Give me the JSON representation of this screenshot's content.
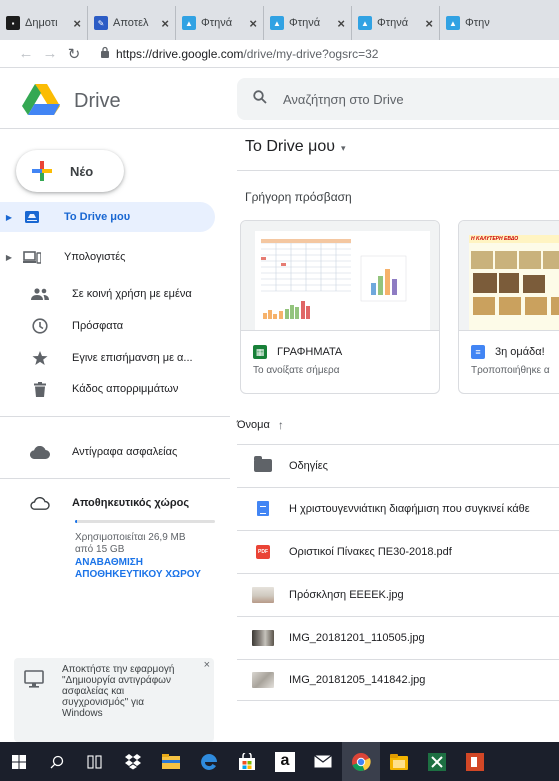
{
  "browser": {
    "tabs": [
      {
        "title": "Δημοτι",
        "close": "×",
        "icon": "school-favicon"
      },
      {
        "title": "Αποτελ",
        "close": "×",
        "icon": "blue-doc-favicon"
      },
      {
        "title": "Φτηνά",
        "close": "×",
        "icon": "flights-favicon"
      },
      {
        "title": "Φτηνά",
        "close": "×",
        "icon": "flights-favicon"
      },
      {
        "title": "Φτηνά",
        "close": "×",
        "icon": "flights-favicon"
      },
      {
        "title": "Φτην",
        "close": "",
        "icon": "flights-favicon"
      }
    ],
    "url_host": "https://drive.google.com",
    "url_path": "/drive/my-drive?ogsrc=32"
  },
  "header": {
    "app_name": "Drive",
    "search_placeholder": "Αναζήτηση στο Drive"
  },
  "sidebar": {
    "new_label": "Νέο",
    "items": [
      {
        "label": "Το Drive μου",
        "icon": "my-drive-icon",
        "active": true,
        "expandable": true
      },
      {
        "label": "Υπολογιστές",
        "icon": "computers-icon",
        "active": false,
        "expandable": true
      },
      {
        "label": "Σε κοινή χρήση με εμένα",
        "icon": "shared-icon",
        "active": false,
        "expandable": false
      },
      {
        "label": "Πρόσφατα",
        "icon": "clock-icon",
        "active": false,
        "expandable": false
      },
      {
        "label": "Εγινε επισήμανση με α...",
        "icon": "star-icon",
        "active": false,
        "expandable": false
      },
      {
        "label": "Κάδος απορριμμάτων",
        "icon": "trash-icon",
        "active": false,
        "expandable": false
      }
    ],
    "backups_label": "Αντίγραφα ασφαλείας",
    "storage_label": "Αποθηκευτικός χώρος",
    "storage_used_fraction": 0.0015,
    "storage_text_1": "Χρησιμοποιείται 26,9 MB",
    "storage_text_2": "από 15 GB",
    "upgrade_1": "ΑΝΑΒΑΘΜΙΣΗ",
    "upgrade_2": "ΑΠΟΘΗΚΕΥΤΙΚΟΥ ΧΩΡΟΥ",
    "promo": {
      "line1": "Αποκτήστε την εφαρμογή",
      "line2": "\"Δημιουργία αντιγράφων",
      "line3": "ασφαλείας και",
      "line4": "συγχρονισμός\" για",
      "line5": "Windows",
      "close": "×"
    }
  },
  "main": {
    "title": "Το Drive μου",
    "title_caret": "▾",
    "quick_access_title": "Γρήγορη πρόσβαση",
    "quick_access": [
      {
        "name": "ΓΡΑΦΗΜΑΤΑ",
        "subtitle": "Το ανοίξατε σήμερα",
        "type": "sheet"
      },
      {
        "name": "3η ομάδα!",
        "subtitle": "Τροποποιήθηκε α",
        "type": "doc",
        "thumb_heading": "Η ΚΑΛΥΤΕΡΗ ΕΒΔΟ"
      }
    ],
    "column_name": "Όνομα",
    "sort_arrow": "↑",
    "files": [
      {
        "name": "Οδηγίες",
        "type": "folder"
      },
      {
        "name": "Η χριστουγεννιάτικη διαφήμιση που συγκινεί κάθε",
        "type": "doc"
      },
      {
        "name": "Οριστικοί Πίνακες ΠΕ30-2018.pdf",
        "type": "pdf",
        "badge": "PDF"
      },
      {
        "name": "Πρόσκληση ΕΕΕΕΚ.jpg",
        "type": "image"
      },
      {
        "name": "IMG_20181201_110505.jpg",
        "type": "image"
      },
      {
        "name": "IMG_20181205_141842.jpg",
        "type": "image"
      }
    ]
  },
  "taskbar": {
    "icons": [
      "windows-start-icon",
      "search-icon",
      "task-view-icon",
      "dropbox-icon",
      "file-explorer-icon",
      "edge-icon",
      "store-icon",
      "amazon-icon",
      "mail-icon",
      "chrome-icon",
      "folder-app-icon",
      "excel-icon",
      "powerpoint-icon"
    ],
    "amazon_glyph": "a"
  },
  "colors": {
    "accent": "#1a73e8",
    "active_bg": "#e8f0fe",
    "active_text": "#1967d2",
    "taskbar": "#1b1f2b"
  }
}
